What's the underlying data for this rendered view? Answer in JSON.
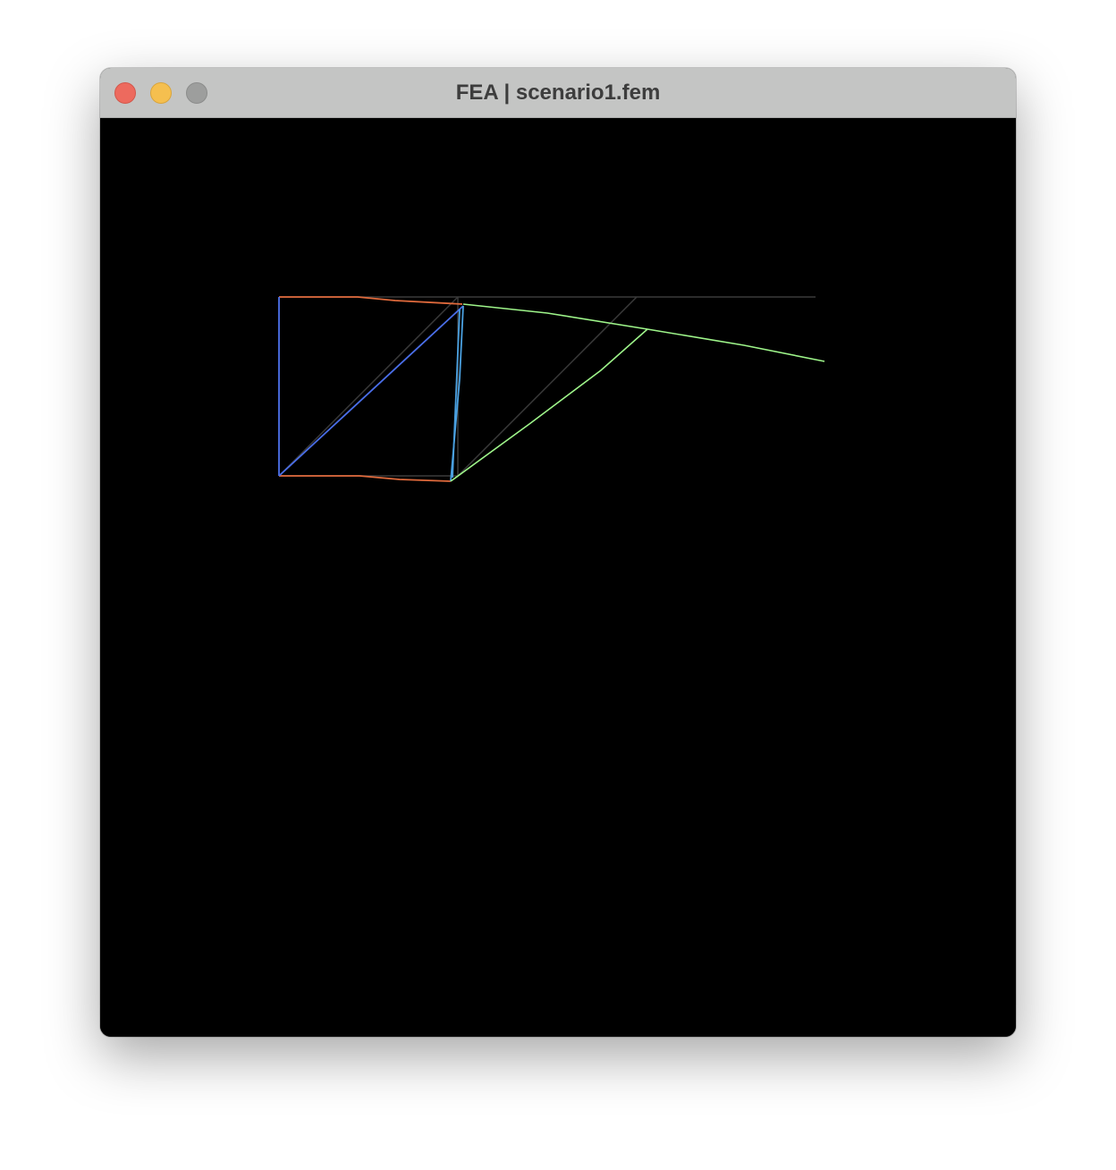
{
  "window": {
    "title": "FEA | scenario1.fem",
    "controls": {
      "close": "close-button",
      "minimize": "minimize-button",
      "zoom": "zoom-button"
    }
  },
  "viewport": {
    "background": "#000000",
    "colors": {
      "undeformed_mesh": "#3a3a3a",
      "element_left": "#4a6ee8",
      "element_left_edges": "#e06a3c",
      "element_right": "#9ef58a",
      "element_mid": "#4aa0e0"
    }
  }
}
